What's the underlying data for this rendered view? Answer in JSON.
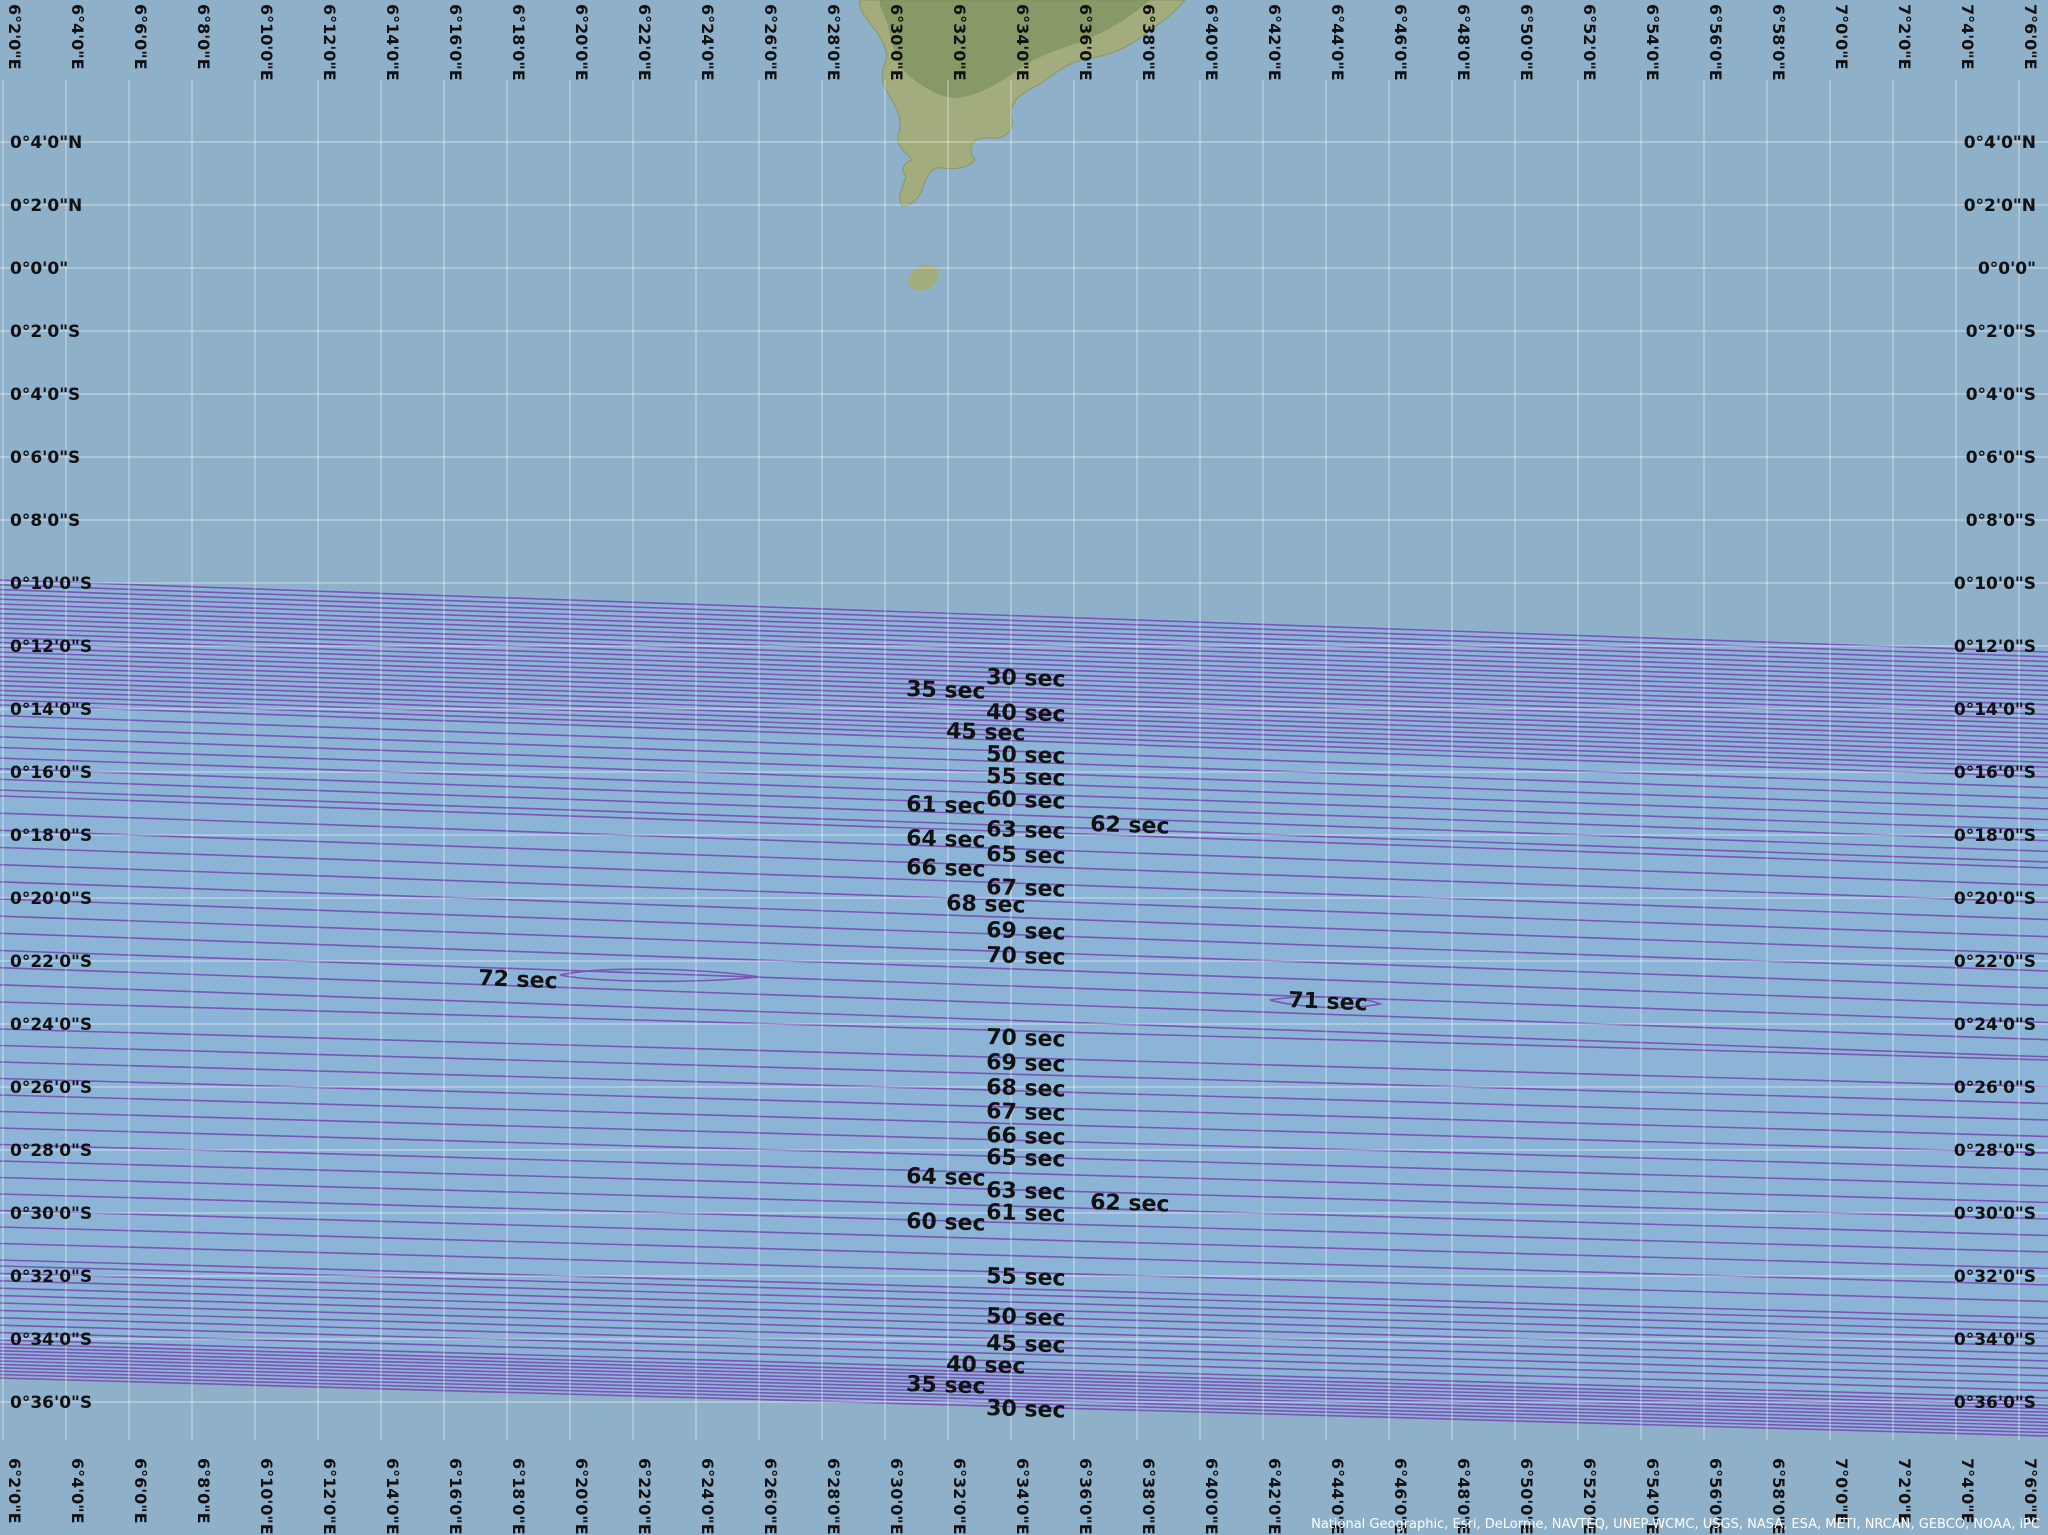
{
  "map": {
    "colors": {
      "ocean": "#8fb0c9",
      "band_ocean": "#8cb4d7",
      "land": "#a3ac7c",
      "land_dark": "#6f8a55",
      "contour": "#7a55b5",
      "grid": "#ffffff",
      "label": "#111111"
    },
    "longitude_ticks": [
      "6°2'0\"E",
      "6°4'0\"E",
      "6°6'0\"E",
      "6°8'0\"E",
      "6°10'0\"E",
      "6°12'0\"E",
      "6°14'0\"E",
      "6°16'0\"E",
      "6°18'0\"E",
      "6°20'0\"E",
      "6°22'0\"E",
      "6°24'0\"E",
      "6°26'0\"E",
      "6°28'0\"E",
      "6°30'0\"E",
      "6°32'0\"E",
      "6°34'0\"E",
      "6°36'0\"E",
      "6°38'0\"E",
      "6°40'0\"E",
      "6°42'0\"E",
      "6°44'0\"E",
      "6°46'0\"E",
      "6°48'0\"E",
      "6°50'0\"E",
      "6°52'0\"E",
      "6°54'0\"E",
      "6°56'0\"E",
      "6°58'0\"E",
      "7°0'0\"E",
      "7°2'0\"E",
      "7°4'0\"E",
      "7°6'0\"E"
    ],
    "latitude_ticks": [
      "0°4'0\"N",
      "0°2'0\"N",
      "0°0'0\"",
      "0°2'0\"S",
      "0°4'0\"S",
      "0°6'0\"S",
      "0°8'0\"S",
      "0°10'0\"S",
      "0°12'0\"S",
      "0°14'0\"S",
      "0°16'0\"S",
      "0°18'0\"S",
      "0°20'0\"S",
      "0°22'0\"S",
      "0°24'0\"S",
      "0°26'0\"S",
      "0°28'0\"S",
      "0°30'0\"S",
      "0°32'0\"S",
      "0°34'0\"S",
      "0°36'0\"S"
    ],
    "contour_labels": [
      "30 sec",
      "35 sec",
      "40 sec",
      "45 sec",
      "50 sec",
      "55 sec",
      "61 sec",
      "60 sec",
      "62 sec",
      "63 sec",
      "64 sec",
      "65 sec",
      "66 sec",
      "67 sec",
      "68 sec",
      "69 sec",
      "70 sec",
      "72 sec",
      "71 sec",
      "70 sec",
      "69 sec",
      "68 sec",
      "67 sec",
      "66 sec",
      "65 sec",
      "64 sec",
      "63 sec",
      "62 sec",
      "61 sec",
      "60 sec",
      "55 sec",
      "50 sec",
      "45 sec",
      "40 sec",
      "35 sec",
      "30 sec"
    ],
    "attribution": "National Geographic, Esri, DeLorme, NAVTEQ, UNEP-WCMC, USGS, NASA, ESA, METI, NRCAN, GEBCO, NOAA, iPC"
  }
}
